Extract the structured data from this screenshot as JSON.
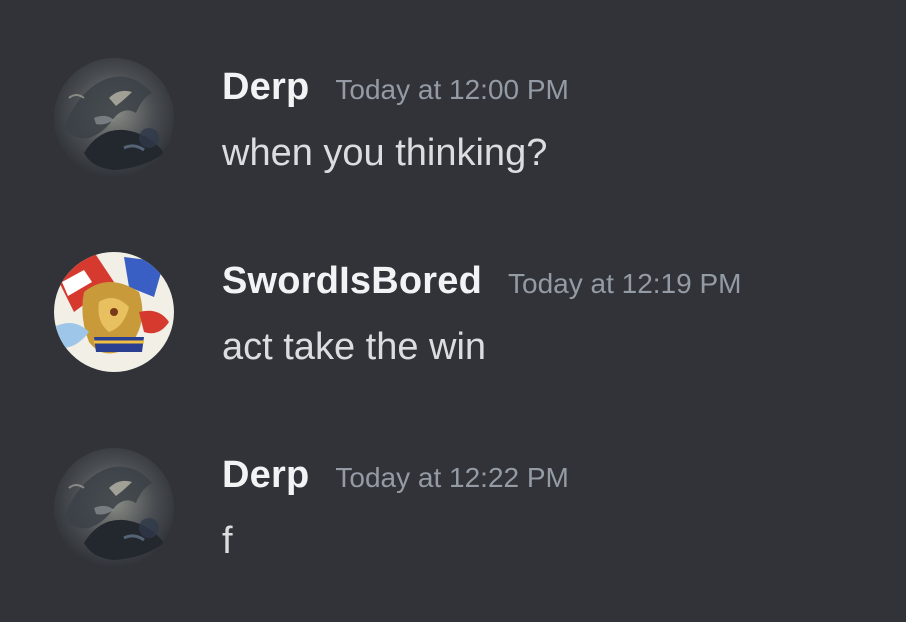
{
  "messages": [
    {
      "author": "Derp",
      "timestamp": "Today at 12:00 PM",
      "content": "when you thinking?",
      "avatar_icon": "dark-creature-avatar-icon"
    },
    {
      "author": "SwordIsBored",
      "timestamp": "Today at 12:19 PM",
      "content": "act take the win",
      "avatar_icon": "colorful-creature-avatar-icon"
    },
    {
      "author": "Derp",
      "timestamp": "Today at 12:22 PM",
      "content": "f",
      "avatar_icon": "dark-creature-avatar-icon"
    }
  ],
  "colors": {
    "background": "#313338",
    "username": "#f2f3f5",
    "timestamp": "#949ba4",
    "message_text": "#dbdee1"
  }
}
